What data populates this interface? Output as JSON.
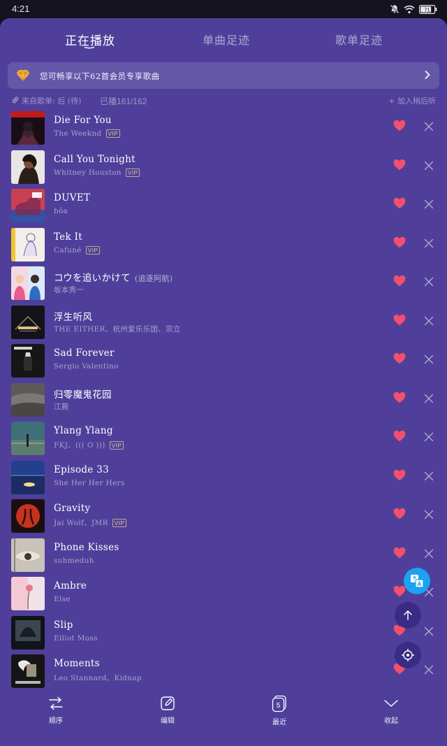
{
  "status": {
    "time": "4:21",
    "battery": "71"
  },
  "tabs": [
    {
      "label": "正在播放",
      "active": true
    },
    {
      "label": "单曲足迹",
      "active": false
    },
    {
      "label": "歌单足迹",
      "active": false
    }
  ],
  "vip_banner": {
    "text": "您可畅享以下62首会员专享歌曲"
  },
  "source": {
    "from": "来自歌单: 后 (待)",
    "count": "已播161/162",
    "add_later": "+ 加入稍后听"
  },
  "songs": [
    {
      "title": "Die For You",
      "artist": "The Weeknd",
      "vip": "VIP",
      "liked": true
    },
    {
      "title": "Call You Tonight",
      "artist": "Whitney Houston",
      "vip": "VIP",
      "liked": true
    },
    {
      "title": "DUVET",
      "artist": "bôa",
      "vip": "",
      "liked": true
    },
    {
      "title": "Tek It",
      "artist": "Cafuné",
      "vip": "VIP",
      "liked": true
    },
    {
      "title": "コウを追いかけて",
      "subtitle": "(追逐阿航)",
      "artist": "坂本秀一",
      "vip": "",
      "liked": true
    },
    {
      "title": "浮生听风",
      "artist": "THE EITHER、杭州爱乐乐团、宗立",
      "vip": "",
      "liked": true
    },
    {
      "title": "Sad Forever",
      "artist": "Sergio Valentino",
      "vip": "",
      "liked": true
    },
    {
      "title": "归零魔鬼花园",
      "artist": "江蕨",
      "vip": "",
      "liked": true
    },
    {
      "title": "Ylang Ylang",
      "artist": "FKJ、((( O )))",
      "vip": "VIP",
      "liked": true
    },
    {
      "title": "Episode 33",
      "artist": "She Her Her Hers",
      "vip": "",
      "liked": true
    },
    {
      "title": "Gravity",
      "artist": "Jai Wolf、JMR",
      "vip": "VIP",
      "liked": true
    },
    {
      "title": "Phone Kisses",
      "artist": "suhmeduh",
      "vip": "",
      "liked": true
    },
    {
      "title": "Ambre",
      "artist": "Else",
      "vip": "",
      "liked": true
    },
    {
      "title": "Slip",
      "artist": "Elliot Moss",
      "vip": "",
      "liked": true
    },
    {
      "title": "Moments",
      "artist": "Leo Stannard、Kidnap",
      "vip": "",
      "liked": true
    }
  ],
  "covers": [
    "starboy",
    "whitney",
    "duvet",
    "tekit",
    "kou",
    "fusheng",
    "sadforever",
    "guiling",
    "ylang",
    "episode",
    "gravity",
    "phone",
    "ambre",
    "slip",
    "moments"
  ],
  "bottom_bar": [
    {
      "label": "顺序",
      "icon": "shuffle-order-icon"
    },
    {
      "label": "编辑",
      "icon": "edit-icon"
    },
    {
      "label": "最近",
      "icon": "recent-icon",
      "badge": "5"
    },
    {
      "label": "收起",
      "icon": "collapse-icon"
    }
  ],
  "colors": {
    "sheet": "#4f3f9a",
    "heart": "#f2506e",
    "accent_blue": "#1da1f2"
  }
}
